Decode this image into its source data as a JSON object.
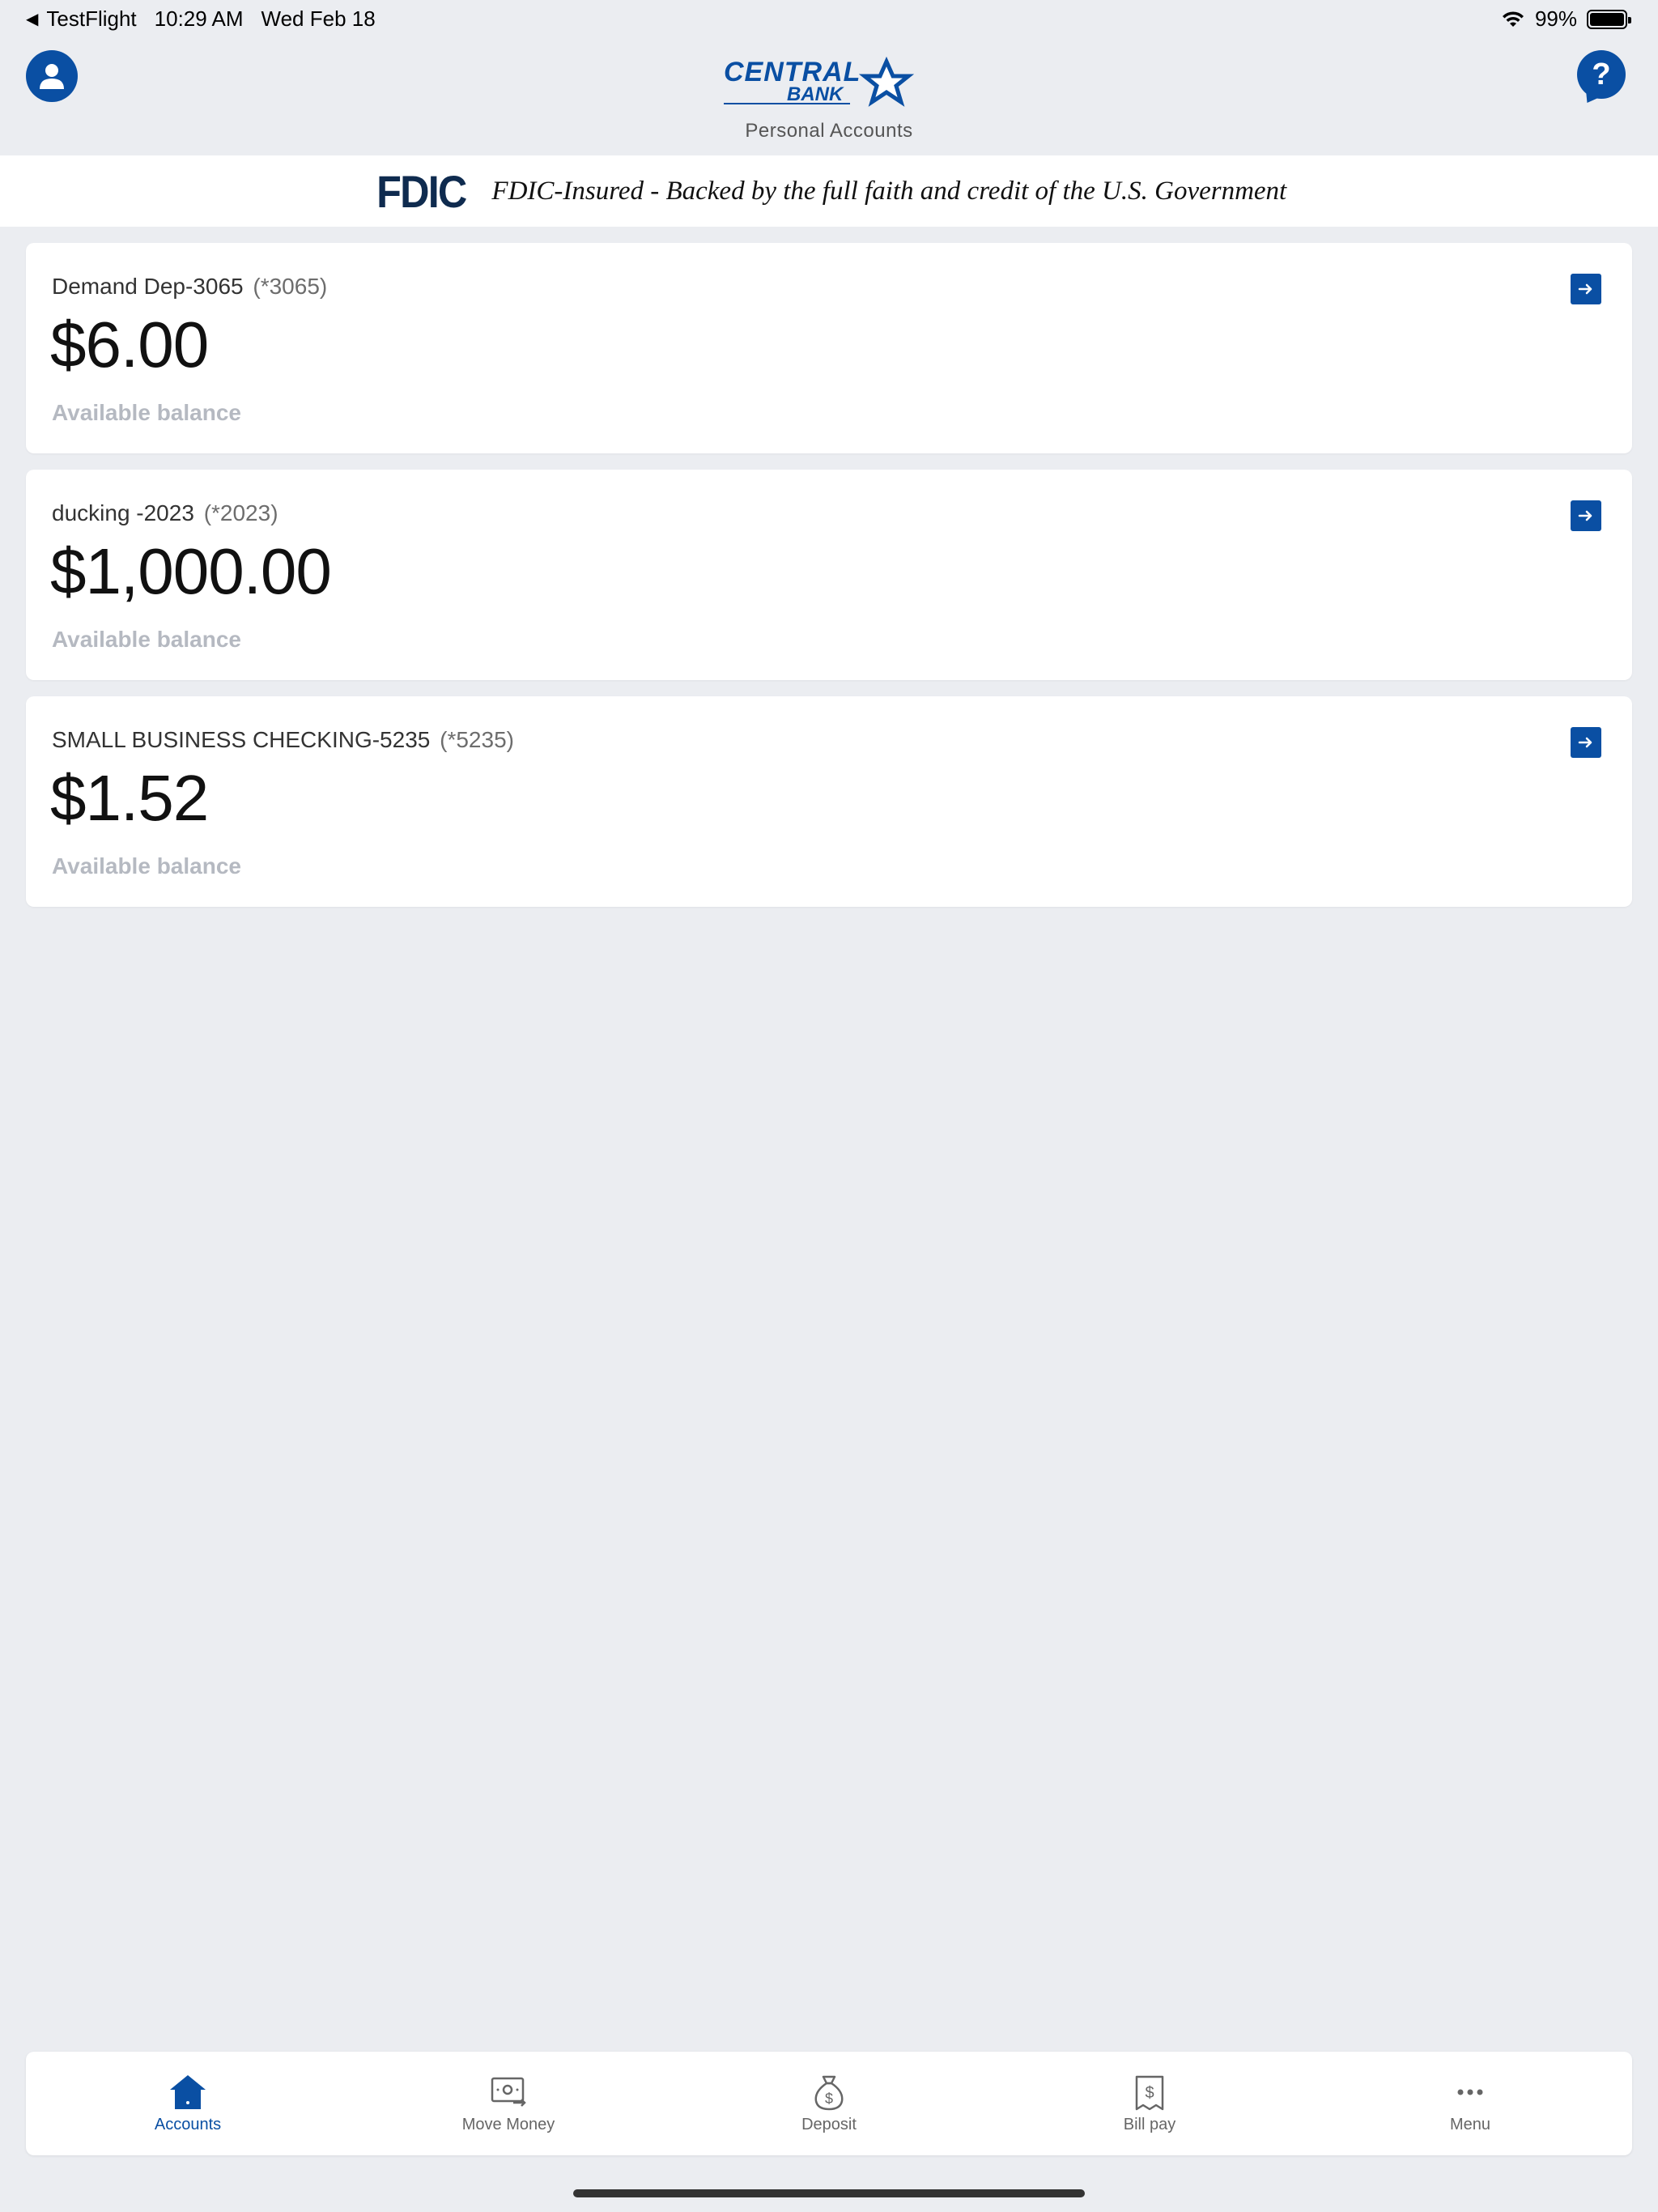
{
  "status_bar": {
    "back_app": "TestFlight",
    "time": "10:29 AM",
    "date": "Wed Feb 18",
    "battery": "99%"
  },
  "header": {
    "logo_text_top": "CENTRAL",
    "logo_text_bottom": "BANK",
    "subtitle": "Personal Accounts"
  },
  "fdic": {
    "logo": "FDIC",
    "text": "FDIC-Insured - Backed by the full faith and credit of the U.S. Government"
  },
  "accounts": [
    {
      "name": "Demand Dep-3065",
      "mask": "(*3065)",
      "balance": "$6.00",
      "label": "Available balance"
    },
    {
      "name": "ducking -2023",
      "mask": "(*2023)",
      "balance": "$1,000.00",
      "label": "Available balance"
    },
    {
      "name": "SMALL BUSINESS CHECKING-5235",
      "mask": "(*5235)",
      "balance": "$1.52",
      "label": "Available balance"
    }
  ],
  "tabs": [
    {
      "label": "Accounts",
      "icon": "home-icon",
      "active": true
    },
    {
      "label": "Move Money",
      "icon": "money-transfer-icon",
      "active": false
    },
    {
      "label": "Deposit",
      "icon": "money-bag-icon",
      "active": false
    },
    {
      "label": "Bill pay",
      "icon": "bill-icon",
      "active": false
    },
    {
      "label": "Menu",
      "icon": "more-icon",
      "active": false
    }
  ],
  "colors": {
    "brand_blue": "#0a4fa3",
    "background": "#ebedf1",
    "fdic_navy": "#0f2b4f"
  }
}
